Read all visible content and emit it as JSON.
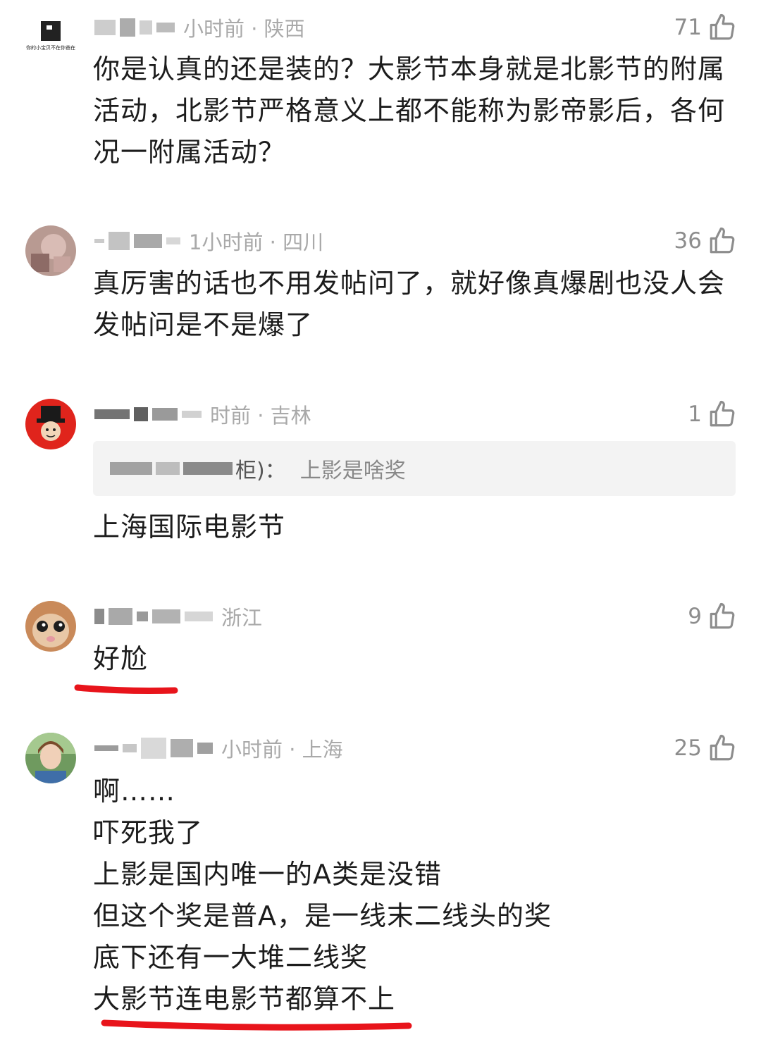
{
  "comments": [
    {
      "avatar_text": "你的小宝贝不在你爸在",
      "time": "小时前 · 陕西",
      "likes": "71",
      "text": "你是认真的还是装的？大影节本身就是北影节的附属活动，北影节严格意义上都不能称为影帝影后，各何况一附属活动？"
    },
    {
      "time": "1小时前 · 四川",
      "likes": "36",
      "text": "真厉害的话也不用发帖问了，就好像真爆剧也没人会发帖问是不是爆了"
    },
    {
      "time": "时前 · 吉林",
      "likes": "1",
      "quote_suffix": "柜)：",
      "quote_text": "上影是啥奖",
      "text": "上海国际电影节"
    },
    {
      "time": "浙江",
      "likes": "9",
      "text": "好尬"
    },
    {
      "time": "小时前 · 上海",
      "likes": "25",
      "lines": [
        "啊……",
        "吓死我了",
        "上影是国内唯一的A类是没错",
        "但这个奖是普A，是一线末二线头的奖",
        "底下还有一大堆二线奖",
        "大影节连电影节都算不上"
      ]
    }
  ],
  "colors": {
    "underline": "#e8141b",
    "meta": "#a9a9a9",
    "quote_bg": "#f3f3f3"
  },
  "icons": {
    "like": "thumbs-up-icon"
  }
}
